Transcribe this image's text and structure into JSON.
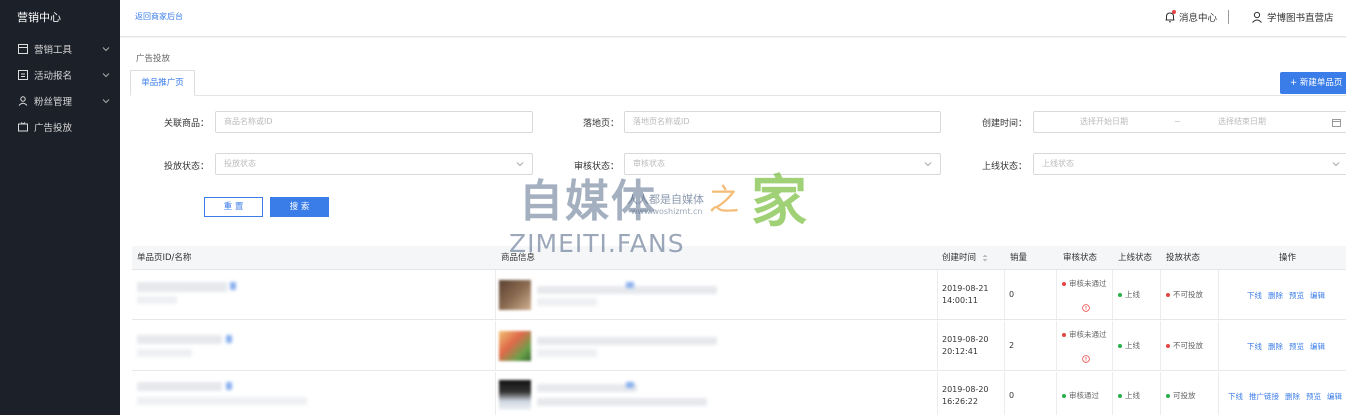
{
  "sidebar": {
    "title": "营销中心",
    "items": [
      {
        "label": "营销工具",
        "icon": "shop-icon",
        "has_arrow": true
      },
      {
        "label": "活动报名",
        "icon": "calendar-icon",
        "has_arrow": true
      },
      {
        "label": "粉丝管理",
        "icon": "users-icon",
        "has_arrow": true
      },
      {
        "label": "广告投放",
        "icon": "ad-icon",
        "has_arrow": false
      }
    ]
  },
  "topbar": {
    "back_link": "返回商家后台",
    "messages": "消息中心",
    "user_name": "学博图书直营店"
  },
  "page": {
    "breadcrumb": "广告投放",
    "tab": "单品推广页",
    "new_button": "+ 新建单品页"
  },
  "filters": {
    "product": {
      "label": "关联商品：",
      "placeholder": "商品名称或ID"
    },
    "landing": {
      "label": "落地页：",
      "placeholder": "落地页名称或ID"
    },
    "created": {
      "label": "创建时间：",
      "start_placeholder": "选择开始日期",
      "separator": "~",
      "end_placeholder": "选择结束日期"
    },
    "delivery_status": {
      "label": "投放状态：",
      "placeholder": "投放状态"
    },
    "review_status": {
      "label": "审核状态：",
      "placeholder": "审核状态"
    },
    "online_status": {
      "label": "上线状态：",
      "placeholder": "上线状态"
    },
    "reset_label": "重 置",
    "search_label": "搜 索"
  },
  "table": {
    "headers": {
      "page": "单品页ID/名称",
      "product": "商品信息",
      "created": "创建时间",
      "sales": "销量",
      "review": "审核状态",
      "online": "上线状态",
      "delivery": "投放状态",
      "ops": "操作"
    },
    "rows": [
      {
        "date": "2019-08-21",
        "time": "14:00:11",
        "sales": "0",
        "review": "审核未通过",
        "review_ok": false,
        "online": "上线",
        "delivery": "不可投放",
        "delivery_ok": false,
        "ops": [
          "下线",
          "删除",
          "预览",
          "编辑"
        ]
      },
      {
        "date": "2019-08-20",
        "time": "20:12:41",
        "sales": "2",
        "review": "审核未通过",
        "review_ok": false,
        "online": "上线",
        "delivery": "不可投放",
        "delivery_ok": false,
        "ops": [
          "下线",
          "删除",
          "预览",
          "编辑"
        ]
      },
      {
        "date": "2019-08-20",
        "time": "16:26:22",
        "sales": "0",
        "review": "审核通过",
        "review_ok": true,
        "online": "上线",
        "delivery": "可投放",
        "delivery_ok": true,
        "ops": [
          "下线",
          "推广链接",
          "删除",
          "预览",
          "编辑"
        ]
      }
    ]
  },
  "watermark": {
    "main": "自媒体",
    "zhi": "之",
    "jia": "家",
    "slogan": "人人都是自媒体",
    "url": "www.woshizmt.cn",
    "english": "ZIMEITI.FANS"
  },
  "colors": {
    "sidebar_bg": "#1c2029",
    "accent": "#3b7de8",
    "status_red": "#e64545",
    "status_green": "#27b148"
  }
}
